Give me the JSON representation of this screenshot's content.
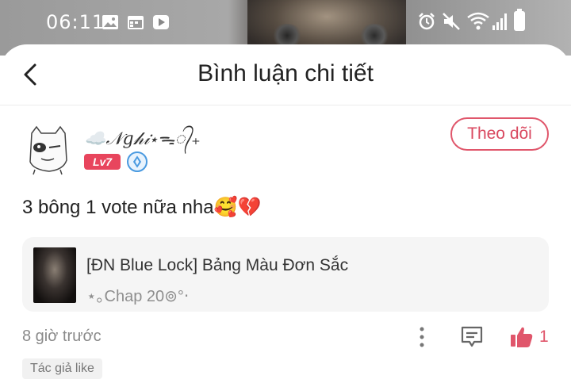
{
  "status_bar": {
    "time": "06:11"
  },
  "header": {
    "title": "Bình luận chi tiết",
    "back_icon": "chevron-left-icon"
  },
  "comment": {
    "username": "☁️𝒩𝑔𝒽𝒾⋆ᯓ᭄₊",
    "level": "Lv7",
    "follow_label": "Theo dõi",
    "text": "3 bông 1 vote nữa nha🥰💔",
    "time_ago": "8 giờ trước",
    "like_count": "1",
    "author_tag": "Tác giả like"
  },
  "story": {
    "title": "[ĐN Blue Lock] Bảng Màu Đơn Sắc",
    "chapter": "⋆｡Chap 20⊚°‧"
  },
  "colors": {
    "accent": "#e0566b",
    "level_badge": "#e8455d",
    "card_bg": "#f5f5f5"
  }
}
